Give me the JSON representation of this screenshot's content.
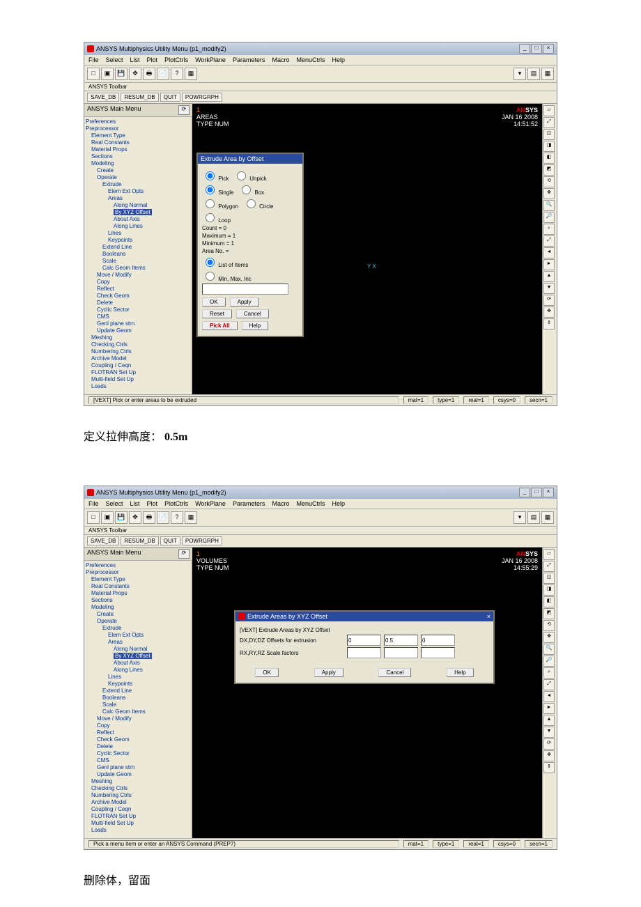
{
  "screenshot1": {
    "window_title": "ANSYS Multiphysics Utility Menu (p1_modify2)",
    "menus": [
      "File",
      "Select",
      "List",
      "Plot",
      "PlotCtrls",
      "WorkPlane",
      "Parameters",
      "Macro",
      "MenuCtrls",
      "Help"
    ],
    "toolbar_label": "ANSYS Toolbar",
    "tabs": [
      "SAVE_DB",
      "RESUM_DB",
      "QUIT",
      "POWRGRPH"
    ],
    "tree_title": "ANSYS Main Menu",
    "tree": [
      {
        "t": "Preferences",
        "cls": "i0"
      },
      {
        "t": "Preprocessor",
        "cls": "i0"
      },
      {
        "t": "Element Type",
        "cls": "i1"
      },
      {
        "t": "Real Constants",
        "cls": "i1"
      },
      {
        "t": "Material Props",
        "cls": "i1"
      },
      {
        "t": "Sections",
        "cls": "i1"
      },
      {
        "t": "Modeling",
        "cls": "i1 hlrow"
      },
      {
        "t": "Create",
        "cls": "i2"
      },
      {
        "t": "Operate",
        "cls": "i2"
      },
      {
        "t": "Extrude",
        "cls": "i3"
      },
      {
        "t": "Elem Ext Opts",
        "cls": "i4"
      },
      {
        "t": "Areas",
        "cls": "i4"
      },
      {
        "t": "Along Normal",
        "cls": "i5"
      },
      {
        "t": "By XYZ Offset",
        "cls": "i5 hl"
      },
      {
        "t": "About Axis",
        "cls": "i5"
      },
      {
        "t": "Along Lines",
        "cls": "i5"
      },
      {
        "t": "Lines",
        "cls": "i4"
      },
      {
        "t": "Keypoints",
        "cls": "i4"
      },
      {
        "t": "Extend Line",
        "cls": "i3"
      },
      {
        "t": "Booleans",
        "cls": "i3"
      },
      {
        "t": "Scale",
        "cls": "i3"
      },
      {
        "t": "Calc Geom Items",
        "cls": "i3"
      },
      {
        "t": "Move / Modify",
        "cls": "i2"
      },
      {
        "t": "Copy",
        "cls": "i2"
      },
      {
        "t": "Reflect",
        "cls": "i2"
      },
      {
        "t": "Check Geom",
        "cls": "i2"
      },
      {
        "t": "Delete",
        "cls": "i2"
      },
      {
        "t": "Cyclic Sector",
        "cls": "i2"
      },
      {
        "t": "CMS",
        "cls": "i2"
      },
      {
        "t": "Genl plane strn",
        "cls": "i2"
      },
      {
        "t": "Update Geom",
        "cls": "i2"
      },
      {
        "t": "Meshing",
        "cls": "i1"
      },
      {
        "t": "Checking Ctrls",
        "cls": "i1"
      },
      {
        "t": "Numbering Ctrls",
        "cls": "i1"
      },
      {
        "t": "Archive Model",
        "cls": "i1"
      },
      {
        "t": "Coupling / Ceqn",
        "cls": "i1"
      },
      {
        "t": "FLOTRAN Set Up",
        "cls": "i1"
      },
      {
        "t": "Multi-field Set Up",
        "cls": "i1"
      },
      {
        "t": "Loads",
        "cls": "i1"
      }
    ],
    "ws": {
      "line1": "AREAS",
      "line2": "TYPE NUM",
      "date": "JAN 16 2008",
      "time": "14:51:52",
      "axis": "Y  X"
    },
    "dialog": {
      "title": "Extrude Area by Offset",
      "radios1": [
        {
          "l": "Pick",
          "c": true
        },
        {
          "l": "Unpick",
          "c": false
        }
      ],
      "radios2": [
        {
          "l": "Single",
          "c": true
        },
        {
          "l": "Box",
          "c": false
        }
      ],
      "radios3": [
        {
          "l": "Polygon",
          "c": false
        },
        {
          "l": "Circle",
          "c": false
        }
      ],
      "radios4": [
        {
          "l": "Loop",
          "c": false
        }
      ],
      "fields": [
        {
          "k": "Count",
          "v": "=  0"
        },
        {
          "k": "Maximum",
          "v": "=  1"
        },
        {
          "k": "Minimum",
          "v": "=  1"
        },
        {
          "k": "Area No.",
          "v": "="
        }
      ],
      "radios5": [
        {
          "l": "List of Items",
          "c": true
        },
        {
          "l": "Min, Max, Inc",
          "c": false
        }
      ],
      "btns1": [
        "OK",
        "Apply"
      ],
      "btns2": [
        "Reset",
        "Cancel"
      ],
      "btns3": [
        "Pick All",
        "Help"
      ]
    },
    "status_left": "[VEXT] Pick or enter areas to be extruded",
    "status": [
      "mat=1",
      "type=1",
      "real=1",
      "csys=0",
      "secn=1"
    ]
  },
  "caption1": {
    "text": "定义拉伸高度：",
    "val": "0.5m"
  },
  "screenshot2": {
    "window_title": "ANSYS Multiphysics Utility Menu (p1_modify2)",
    "menus": [
      "File",
      "Select",
      "List",
      "Plot",
      "PlotCtrls",
      "WorkPlane",
      "Parameters",
      "Macro",
      "MenuCtrls",
      "Help"
    ],
    "toolbar_label": "ANSYS Toolbar",
    "tabs": [
      "SAVE_DB",
      "RESUM_DB",
      "QUIT",
      "POWRGRPH"
    ],
    "tree_title": "ANSYS Main Menu",
    "tree": [
      {
        "t": "Preferences",
        "cls": "i0"
      },
      {
        "t": "Preprocessor",
        "cls": "i0"
      },
      {
        "t": "Element Type",
        "cls": "i1"
      },
      {
        "t": "Real Constants",
        "cls": "i1"
      },
      {
        "t": "Material Props",
        "cls": "i1"
      },
      {
        "t": "Sections",
        "cls": "i1"
      },
      {
        "t": "Modeling",
        "cls": "i1"
      },
      {
        "t": "Create",
        "cls": "i2"
      },
      {
        "t": "Operate",
        "cls": "i2"
      },
      {
        "t": "Extrude",
        "cls": "i3"
      },
      {
        "t": "Elem Ext Opts",
        "cls": "i4"
      },
      {
        "t": "Areas",
        "cls": "i4"
      },
      {
        "t": "Along Normal",
        "cls": "i5"
      },
      {
        "t": "By XYZ Offset",
        "cls": "i5 hl"
      },
      {
        "t": "About Axis",
        "cls": "i5"
      },
      {
        "t": "Along Lines",
        "cls": "i5"
      },
      {
        "t": "Lines",
        "cls": "i4"
      },
      {
        "t": "Keypoints",
        "cls": "i4"
      },
      {
        "t": "Extend Line",
        "cls": "i3"
      },
      {
        "t": "Booleans",
        "cls": "i3"
      },
      {
        "t": "Scale",
        "cls": "i3"
      },
      {
        "t": "Calc Geom Items",
        "cls": "i3"
      },
      {
        "t": "Move / Modify",
        "cls": "i2"
      },
      {
        "t": "Copy",
        "cls": "i2"
      },
      {
        "t": "Reflect",
        "cls": "i2"
      },
      {
        "t": "Check Geom",
        "cls": "i2"
      },
      {
        "t": "Delete",
        "cls": "i2"
      },
      {
        "t": "Cyclic Sector",
        "cls": "i2"
      },
      {
        "t": "CMS",
        "cls": "i2"
      },
      {
        "t": "Genl plane strn",
        "cls": "i2"
      },
      {
        "t": "Update Geom",
        "cls": "i2"
      },
      {
        "t": "Meshing",
        "cls": "i1"
      },
      {
        "t": "Checking Ctrls",
        "cls": "i1"
      },
      {
        "t": "Numbering Ctrls",
        "cls": "i1"
      },
      {
        "t": "Archive Model",
        "cls": "i1"
      },
      {
        "t": "Coupling / Ceqn",
        "cls": "i1"
      },
      {
        "t": "FLOTRAN Set Up",
        "cls": "i1"
      },
      {
        "t": "Multi-field Set Up",
        "cls": "i1"
      },
      {
        "t": "Loads",
        "cls": "i1"
      }
    ],
    "ws": {
      "line1": "VOLUMES",
      "line2": "TYPE NUM",
      "date": "JAN 16 2008",
      "time": "14:55:29"
    },
    "dialog": {
      "title": "Extrude Areas by XYZ Offset",
      "line1": "[VEXT] Extrude Areas by XYZ Offset",
      "field1": {
        "label": "DX,DY,DZ Offsets for extrusion",
        "v": [
          "0",
          "0.5",
          "0"
        ]
      },
      "field2": {
        "label": "RX,RY,RZ Scale factors",
        "v": [
          "",
          "",
          ""
        ]
      },
      "btns": [
        "OK",
        "Apply",
        "Cancel",
        "Help"
      ]
    },
    "status_left": "Pick a menu item or enter an ANSYS Command (PREP7)",
    "status": [
      "mat=1",
      "type=1",
      "real=1",
      "csys=0",
      "secn=1"
    ]
  },
  "caption2": {
    "text": "删除体，留面"
  }
}
